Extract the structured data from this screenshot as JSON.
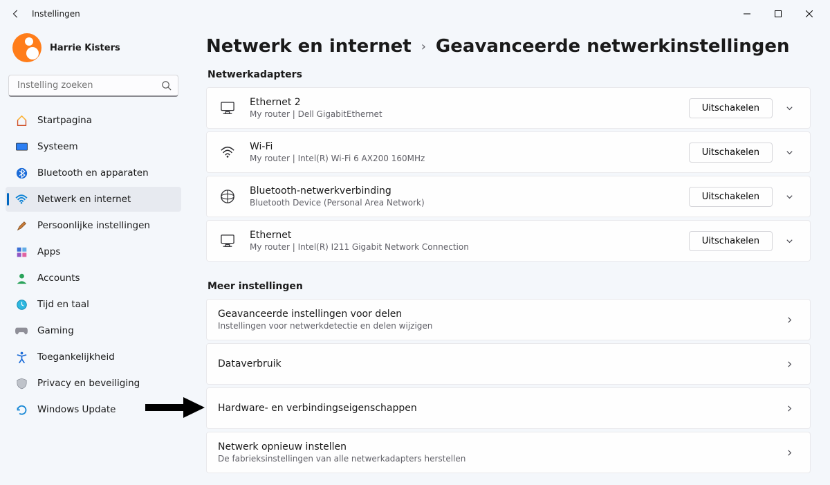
{
  "window": {
    "title": "Instellingen"
  },
  "user": {
    "name": "Harrie Kisters"
  },
  "search": {
    "placeholder": "Instelling zoeken"
  },
  "sidebar": {
    "items": [
      {
        "label": "Startpagina"
      },
      {
        "label": "Systeem"
      },
      {
        "label": "Bluetooth en apparaten"
      },
      {
        "label": "Netwerk en internet"
      },
      {
        "label": "Persoonlijke instellingen"
      },
      {
        "label": "Apps"
      },
      {
        "label": "Accounts"
      },
      {
        "label": "Tijd en taal"
      },
      {
        "label": "Gaming"
      },
      {
        "label": "Toegankelijkheid"
      },
      {
        "label": "Privacy en beveiliging"
      },
      {
        "label": "Windows Update"
      }
    ],
    "active_index": 3
  },
  "breadcrumb": {
    "parent": "Netwerk en internet",
    "current": "Geavanceerde netwerkinstellingen"
  },
  "sections": {
    "adapters": {
      "title": "Netwerkadapters",
      "items": [
        {
          "title": "Ethernet 2",
          "sub": "My router | Dell GigabitEthernet",
          "button": "Uitschakelen",
          "icon": "ethernet"
        },
        {
          "title": "Wi-Fi",
          "sub": "My router | Intel(R) Wi-Fi 6 AX200 160MHz",
          "button": "Uitschakelen",
          "icon": "wifi"
        },
        {
          "title": "Bluetooth-netwerkverbinding",
          "sub": "Bluetooth Device (Personal Area Network)",
          "button": "Uitschakelen",
          "icon": "bt-pan"
        },
        {
          "title": "Ethernet",
          "sub": "My router | Intel(R) I211 Gigabit Network Connection",
          "button": "Uitschakelen",
          "icon": "ethernet"
        }
      ]
    },
    "more": {
      "title": "Meer instellingen",
      "items": [
        {
          "title": "Geavanceerde instellingen voor delen",
          "sub": "Instellingen voor netwerkdetectie en delen wijzigen"
        },
        {
          "title": "Dataverbruik",
          "sub": ""
        },
        {
          "title": "Hardware- en verbindingseigenschappen",
          "sub": ""
        },
        {
          "title": "Netwerk opnieuw instellen",
          "sub": "De fabrieksinstellingen van alle netwerkadapters herstellen"
        }
      ]
    }
  }
}
